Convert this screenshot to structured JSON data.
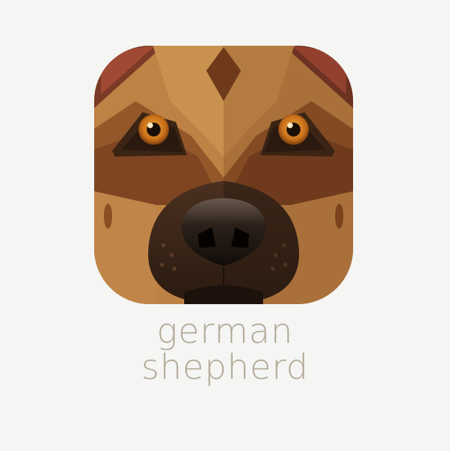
{
  "logo": {
    "icon": "german-shepherd-face-icon",
    "caption_line1": "german",
    "caption_line2": "shepherd"
  },
  "colors": {
    "background": "#f5f5f4",
    "caption_text": "#b3ab98",
    "fur_light": "#c38a49",
    "fur_mid": "#a86b33",
    "fur_dark": "#7a4420",
    "ear_inner": "#8e3a2a",
    "muzzle": "#3a2416",
    "nose": "#1b1410",
    "eye_iris": "#d0791b"
  }
}
